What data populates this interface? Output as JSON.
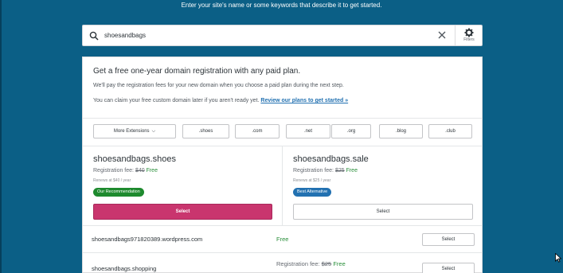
{
  "header": {
    "subtitle": "Enter your site's name or some keywords that describe it to get started."
  },
  "search": {
    "query": "shoesandbags",
    "filters_label": "Filters"
  },
  "promo": {
    "title": "Get a free one-year domain registration with any paid plan.",
    "line1": "We'll pay the registration fees for your new domain when you choose a paid plan during the next step.",
    "line2": "You can claim your free custom domain later if you aren't ready yet.",
    "link": "Review our plans to get started »"
  },
  "tlds": {
    "more_extensions": "More Extensions",
    "items": [
      ".shoes",
      ".com",
      ".net",
      ".org",
      ".blog",
      ".club"
    ]
  },
  "featured": [
    {
      "domain": "shoesandbags.shoes",
      "fee_label": "Registration fee:",
      "old_price": "$40",
      "free": "Free",
      "renews": "Renews at $40 / year",
      "badge": "Our Recommendation",
      "select": "Select"
    },
    {
      "domain": "shoesandbags.sale",
      "fee_label": "Registration fee:",
      "old_price": "$25",
      "free": "Free",
      "renews": "Renews at $25 / year",
      "badge": "Best Alternative",
      "select": "Select"
    }
  ],
  "rows": [
    {
      "domain": "shoesandbags971820389.wordpress.com",
      "free": "Free",
      "select": "Select"
    },
    {
      "domain": "shoesandbags.shopping",
      "fee_label": "Registration fee:",
      "old_price": "$25",
      "free": "Free",
      "select": "Select"
    }
  ],
  "colors": {
    "background": "#0b5f86",
    "primary_button": "#c9356e",
    "free_green": "#2a8f3b",
    "recommendation_badge": "#1e8a2e",
    "alternative_badge": "#2271b1",
    "link": "#2271b1"
  },
  "icons": {
    "search": "search-icon",
    "clear": "close-icon",
    "filters": "gear-icon",
    "chevron": "chevron-down-icon",
    "cursor": "mouse-pointer-icon"
  }
}
